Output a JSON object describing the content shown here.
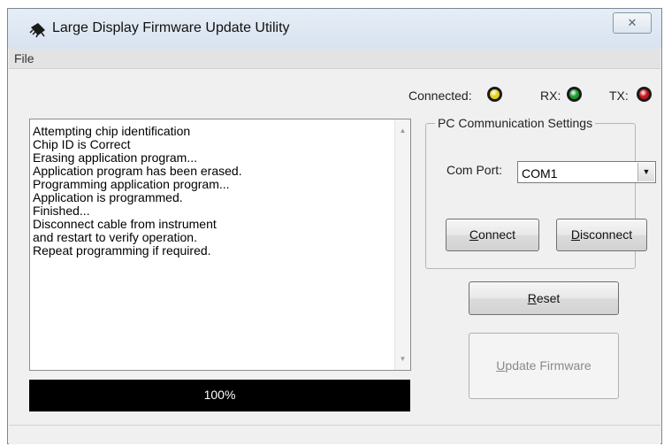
{
  "window": {
    "title": "Large Display Firmware Update Utility",
    "close_glyph": "✕"
  },
  "menu": {
    "file": "File"
  },
  "status": {
    "connected_label": "Connected:",
    "rx_label": "RX:",
    "tx_label": "TX:",
    "connected_led_color": "#e0d21a",
    "rx_led_color": "#1f9a2c",
    "tx_led_color": "#c8141c"
  },
  "log": {
    "lines": [
      "Attempting chip identification",
      "Chip ID is Correct",
      "Erasing application program...",
      "Application program has been erased.",
      "Programming application program...",
      "Application is programmed.",
      "Finished...",
      "Disconnect cable from instrument",
      "and restart to verify operation.",
      "Repeat programming if required."
    ]
  },
  "progress": {
    "value": 1.0,
    "label": "100%"
  },
  "settings": {
    "group_title": "PC Communication Settings",
    "com_port_label": "Com Port:",
    "com_port_value": "COM1",
    "connect_label": "Connect",
    "disconnect_label": "Disconnect"
  },
  "actions": {
    "reset_label": "Reset",
    "update_label": "Update Firmware"
  }
}
